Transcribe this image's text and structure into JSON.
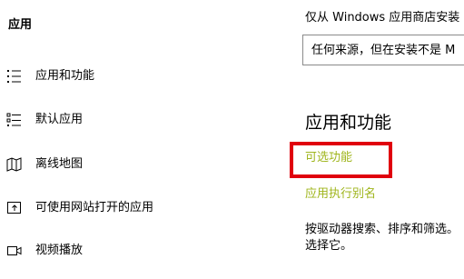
{
  "sidebar": {
    "title": "应用",
    "items": [
      {
        "label": "应用和功能",
        "icon": "apps-list-icon"
      },
      {
        "label": "默认应用",
        "icon": "default-apps-icon"
      },
      {
        "label": "离线地图",
        "icon": "offline-map-icon"
      },
      {
        "label": "可使用网站打开的应用",
        "icon": "open-with-website-icon"
      },
      {
        "label": "视频播放",
        "icon": "video-playback-icon"
      }
    ]
  },
  "main": {
    "source_label": "仅从 Windows 应用商店安装",
    "source_select_value": "任何来源，但在安装不是 M",
    "section_heading": "应用和功能",
    "optional_features_link": "可选功能",
    "app_execution_alias_link": "应用执行别名",
    "description_line1": "按驱动器搜索、排序和筛选。",
    "description_line2": "选择它。"
  },
  "colors": {
    "link": "#9fb51c",
    "highlight": "#e0000e"
  }
}
